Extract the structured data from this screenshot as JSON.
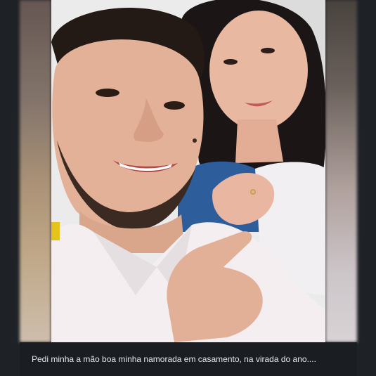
{
  "post": {
    "caption": "Pedi minha a mão boa minha namorada em casamento, na virada do ano...."
  },
  "colors": {
    "background": "#1e2227",
    "caption_bar": "#1a1d21",
    "caption_text": "#e6e8eb"
  }
}
